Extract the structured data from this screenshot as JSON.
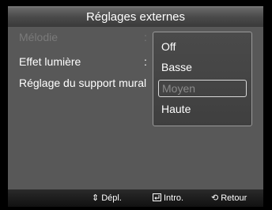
{
  "title": "Réglages externes",
  "menu": [
    {
      "label": "Mélodie",
      "state": "disabled"
    },
    {
      "label": "Effet lumière",
      "state": "normal"
    },
    {
      "label": "Réglage du support mural",
      "state": "normal"
    }
  ],
  "dropdown": {
    "options": [
      "Off",
      "Basse",
      "Moyen",
      "Haute"
    ],
    "selected": "Moyen"
  },
  "footer": {
    "move_icon": "updown-arrows-icon",
    "move_label": "Dépl.",
    "enter_icon": "enter-icon",
    "enter_label": "Intro.",
    "return_icon": "return-icon",
    "return_label": "Retour"
  },
  "colors": {
    "panel": "#585858",
    "disabled_text": "#7a7a7a",
    "selected_text": "#8a8a8a"
  }
}
